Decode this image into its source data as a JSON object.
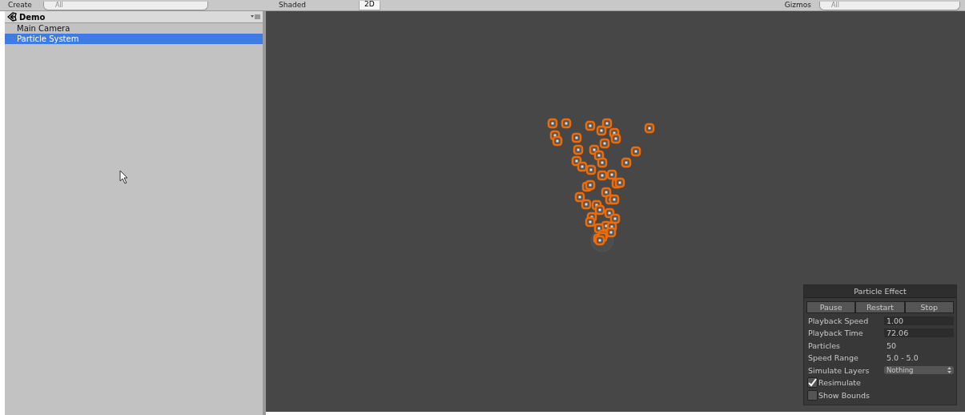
{
  "toolbar": {
    "create": "Create",
    "search_placeholder": "All",
    "shading": "Shaded",
    "mode_2d": "2D",
    "gizmos": "Gizmos",
    "scene_search_placeholder": "All"
  },
  "hierarchy": {
    "scene": "Demo",
    "items": [
      {
        "label": "Main Camera",
        "selected": false
      },
      {
        "label": "Particle System",
        "selected": true
      }
    ]
  },
  "particle_effect": {
    "title": "Particle Effect",
    "buttons": [
      "Pause",
      "Restart",
      "Stop"
    ],
    "fields": [
      {
        "kind": "input",
        "label": "Playback Speed",
        "value": "1.00"
      },
      {
        "kind": "input",
        "label": "Playback Time",
        "value": "72.06"
      },
      {
        "kind": "text",
        "label": "Particles",
        "value": "50"
      },
      {
        "kind": "text",
        "label": "Speed Range",
        "value": "5.0 - 5.0"
      },
      {
        "kind": "dropdown",
        "label": "Simulate Layers",
        "value": "Nothing"
      }
    ],
    "toggles": [
      {
        "label": "Resimulate",
        "checked": true
      },
      {
        "label": "Show Bounds",
        "checked": false
      }
    ]
  }
}
